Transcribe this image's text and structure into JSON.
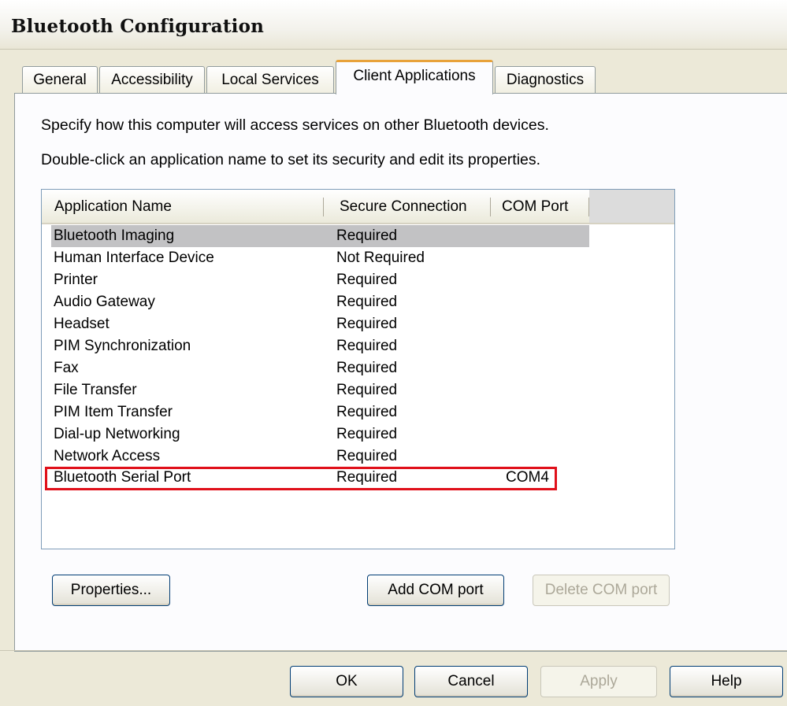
{
  "window": {
    "title": "Bluetooth Configuration"
  },
  "tabs": [
    {
      "label": "General",
      "active": false
    },
    {
      "label": "Accessibility",
      "active": false
    },
    {
      "label": "Local Services",
      "active": false
    },
    {
      "label": "Client Applications",
      "active": true
    },
    {
      "label": "Diagnostics",
      "active": false
    }
  ],
  "description": {
    "line1": "Specify how this computer will access services on other Bluetooth devices.",
    "line2": "Double-click an application name to set its security and edit its properties."
  },
  "list": {
    "columns": [
      "Application Name",
      "Secure Connection",
      "COM Port"
    ],
    "rows": [
      {
        "name": "Bluetooth Imaging",
        "secure": "Required",
        "com": ""
      },
      {
        "name": "Human Interface Device",
        "secure": "Not Required",
        "com": ""
      },
      {
        "name": "Printer",
        "secure": "Required",
        "com": ""
      },
      {
        "name": "Audio Gateway",
        "secure": "Required",
        "com": ""
      },
      {
        "name": "Headset",
        "secure": "Required",
        "com": ""
      },
      {
        "name": "PIM Synchronization",
        "secure": "Required",
        "com": ""
      },
      {
        "name": "Fax",
        "secure": "Required",
        "com": ""
      },
      {
        "name": "File Transfer",
        "secure": "Required",
        "com": ""
      },
      {
        "name": "PIM Item Transfer",
        "secure": "Required",
        "com": ""
      },
      {
        "name": "Dial-up Networking",
        "secure": "Required",
        "com": ""
      },
      {
        "name": "Network Access",
        "secure": "Required",
        "com": ""
      },
      {
        "name": "Bluetooth Serial Port",
        "secure": "Required",
        "com": "COM4"
      }
    ],
    "selected_row": "Bluetooth Imaging",
    "highlighted_row": "Bluetooth Serial Port"
  },
  "panel_buttons": {
    "properties": "Properties...",
    "add_com": "Add COM port",
    "delete_com": "Delete COM port"
  },
  "dialog_buttons": {
    "ok": "OK",
    "cancel": "Cancel",
    "apply": "Apply",
    "help": "Help"
  },
  "colors": {
    "highlight_border": "#e0101a",
    "selected_row": "#c2c2c4",
    "active_tab_accent": "#e8a23a"
  }
}
